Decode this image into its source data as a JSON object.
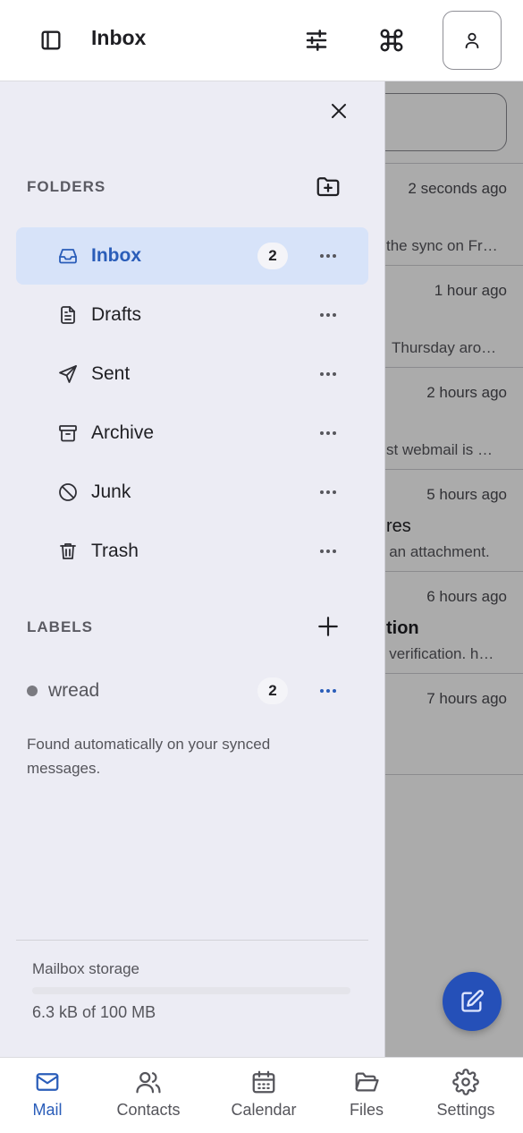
{
  "header": {
    "title": "Inbox"
  },
  "background_list": {
    "rows": [
      {
        "time": "2 seconds ago",
        "subject": "",
        "preview": "the sync on Fr…"
      },
      {
        "time": "1 hour ago",
        "subject": "",
        "preview": "Thursday aro…"
      },
      {
        "time": "2 hours ago",
        "subject": "",
        "preview": "st webmail is …"
      },
      {
        "time": "5 hours ago",
        "subject": "res",
        "preview": "s an attachment."
      },
      {
        "time": "6 hours ago",
        "subject": "tion",
        "preview": "s verification. h…"
      },
      {
        "time": "7 hours ago",
        "subject": "",
        "preview": ""
      }
    ]
  },
  "drawer": {
    "folders_title": "FOLDERS",
    "folders": [
      {
        "label": "Inbox",
        "count": "2",
        "icon": "inbox-icon",
        "active": true
      },
      {
        "label": "Drafts",
        "icon": "drafts-icon"
      },
      {
        "label": "Sent",
        "icon": "sent-icon"
      },
      {
        "label": "Archive",
        "icon": "archive-icon"
      },
      {
        "label": "Junk",
        "icon": "junk-icon"
      },
      {
        "label": "Trash",
        "icon": "trash-icon"
      }
    ],
    "labels_title": "LABELS",
    "labels": [
      {
        "name": "wread",
        "count": "2"
      }
    ],
    "labels_hint": "Found automatically on your synced messages.",
    "storage": {
      "label": "Mailbox storage",
      "value": "6.3 kB of 100 MB",
      "used_fraction": 6.3e-05
    }
  },
  "tabs": [
    {
      "label": "Mail",
      "icon": "mail-icon",
      "active": true
    },
    {
      "label": "Contacts",
      "icon": "contacts-icon"
    },
    {
      "label": "Calendar",
      "icon": "calendar-icon"
    },
    {
      "label": "Files",
      "icon": "files-icon"
    },
    {
      "label": "Settings",
      "icon": "settings-icon"
    }
  ],
  "colors": {
    "accent": "#2a5db9",
    "drawer_bg": "#ececf4",
    "active_bg": "#d7e3f9",
    "fab": "#2550b8"
  }
}
